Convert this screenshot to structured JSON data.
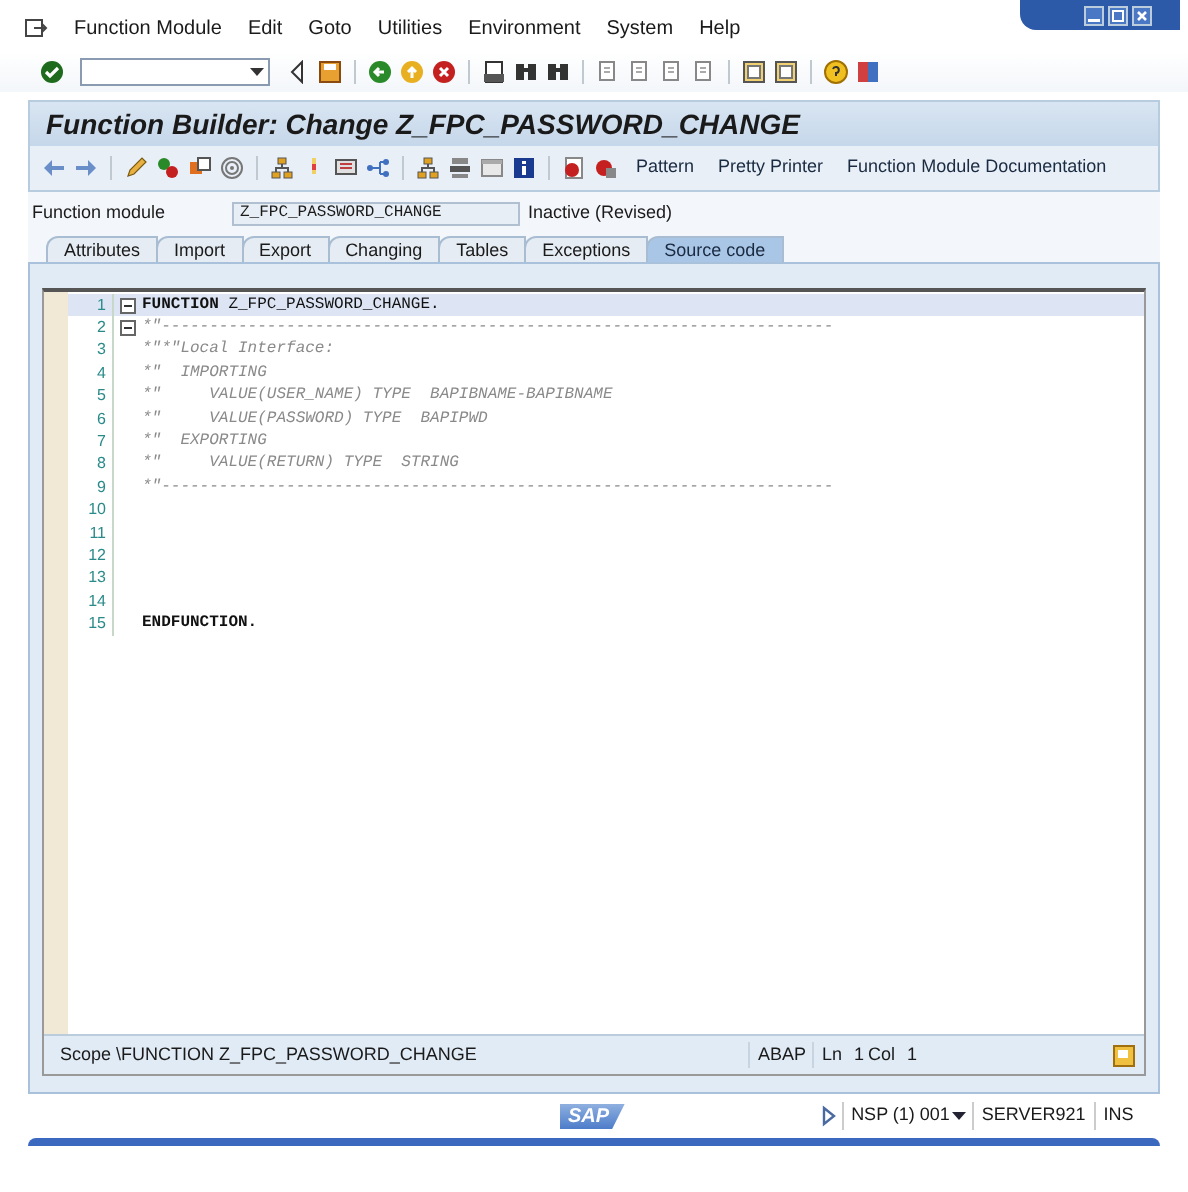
{
  "menu": [
    "Function Module",
    "Edit",
    "Goto",
    "Utilities",
    "Environment",
    "System",
    "Help"
  ],
  "title": "Function Builder: Change Z_FPC_PASSWORD_CHANGE",
  "app_toolbar": {
    "buttons": [
      "Pattern",
      "Pretty Printer",
      "Function Module Documentation"
    ]
  },
  "function_module": {
    "label": "Function module",
    "value": "Z_FPC_PASSWORD_CHANGE",
    "status": "Inactive (Revised)"
  },
  "tabs": [
    {
      "label": "Attributes",
      "selected": false
    },
    {
      "label": "Import",
      "selected": false
    },
    {
      "label": "Export",
      "selected": false
    },
    {
      "label": "Changing",
      "selected": false
    },
    {
      "label": "Tables",
      "selected": false
    },
    {
      "label": "Exceptions",
      "selected": false
    },
    {
      "label": "Source code",
      "selected": true
    }
  ],
  "code": [
    {
      "number": "1",
      "text": "**FUNCTION** Z_FPC_PASSWORD_CHANGE.",
      "kind": "code",
      "fold": true,
      "current": true
    },
    {
      "number": "2",
      "text": "*\"----------------------------------------------------------------------",
      "kind": "comment",
      "fold": true,
      "current": false
    },
    {
      "number": "3",
      "text": "*\"*\"Local Interface:",
      "kind": "comment",
      "fold": false,
      "current": false
    },
    {
      "number": "4",
      "text": "*\"  IMPORTING",
      "kind": "comment",
      "fold": false,
      "current": false
    },
    {
      "number": "5",
      "text": "*\"     VALUE(USER_NAME) TYPE  BAPIBNAME-BAPIBNAME",
      "kind": "comment",
      "fold": false,
      "current": false
    },
    {
      "number": "6",
      "text": "*\"     VALUE(PASSWORD) TYPE  BAPIPWD",
      "kind": "comment",
      "fold": false,
      "current": false
    },
    {
      "number": "7",
      "text": "*\"  EXPORTING",
      "kind": "comment",
      "fold": false,
      "current": false
    },
    {
      "number": "8",
      "text": "*\"     VALUE(RETURN) TYPE  STRING",
      "kind": "comment",
      "fold": false,
      "current": false
    },
    {
      "number": "9",
      "text": "*\"----------------------------------------------------------------------",
      "kind": "comment",
      "fold": false,
      "current": false
    },
    {
      "number": "10",
      "kind": "blank",
      "fold": false,
      "current": false
    },
    {
      "number": "11",
      "kind": "blank",
      "fold": false,
      "current": false
    },
    {
      "number": "12",
      "kind": "blank",
      "fold": false,
      "current": false
    },
    {
      "number": "13",
      "kind": "blank",
      "fold": false,
      "current": false
    },
    {
      "number": "14",
      "kind": "blank",
      "fold": false,
      "current": false
    },
    {
      "number": "15",
      "text": "ENDFUNCTION.",
      "kind": "keyword",
      "fold": false,
      "current": false
    }
  ],
  "status": {
    "scope": "Scope \\FUNCTION Z_FPC_PASSWORD_CHANGE",
    "language": "ABAP",
    "ln_label": "Ln",
    "ln": "1",
    "col_label": "Col",
    "col": "1"
  },
  "logo": "SAP",
  "system_bar": {
    "system": "NSP (1) 001",
    "server": "SERVER921",
    "mode": "INS"
  }
}
